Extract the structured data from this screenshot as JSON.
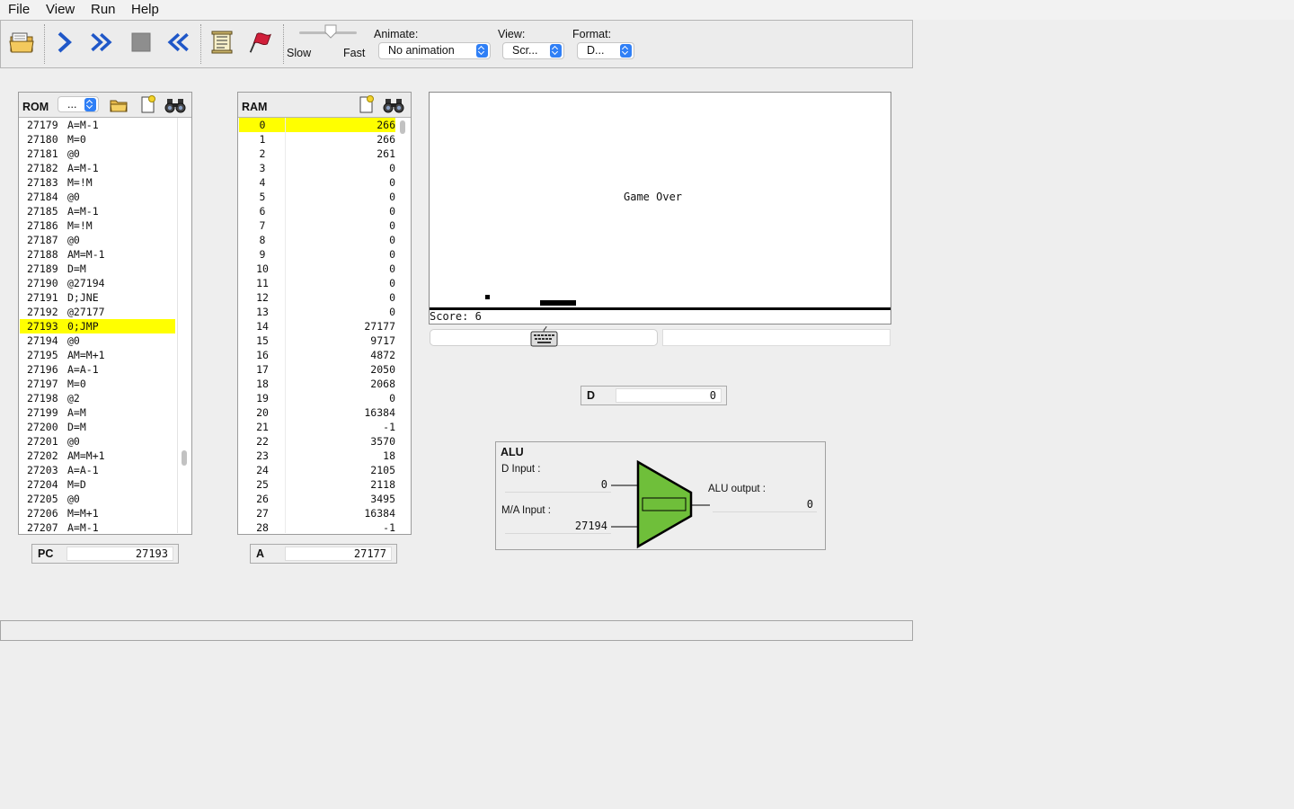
{
  "menu": [
    "File",
    "View",
    "Run",
    "Help"
  ],
  "toolbar": {
    "speed_slow": "Slow",
    "speed_fast": "Fast",
    "speed_level": 0.55,
    "animate_label": "Animate:",
    "animate_value": "No animation",
    "view_label": "View:",
    "view_value": "Scr...",
    "format_label": "Format:",
    "format_value": "D..."
  },
  "rom": {
    "title": "ROM",
    "combo_value": "...",
    "highlighted_index": 14,
    "rows": [
      {
        "addr": "27179",
        "inst": "A=M-1"
      },
      {
        "addr": "27180",
        "inst": "M=0"
      },
      {
        "addr": "27181",
        "inst": "@0"
      },
      {
        "addr": "27182",
        "inst": "A=M-1"
      },
      {
        "addr": "27183",
        "inst": "M=!M"
      },
      {
        "addr": "27184",
        "inst": "@0"
      },
      {
        "addr": "27185",
        "inst": "A=M-1"
      },
      {
        "addr": "27186",
        "inst": "M=!M"
      },
      {
        "addr": "27187",
        "inst": "@0"
      },
      {
        "addr": "27188",
        "inst": "AM=M-1"
      },
      {
        "addr": "27189",
        "inst": "D=M"
      },
      {
        "addr": "27190",
        "inst": "@27194"
      },
      {
        "addr": "27191",
        "inst": "D;JNE"
      },
      {
        "addr": "27192",
        "inst": "@27177"
      },
      {
        "addr": "27193",
        "inst": "0;JMP"
      },
      {
        "addr": "27194",
        "inst": "@0"
      },
      {
        "addr": "27195",
        "inst": "AM=M+1"
      },
      {
        "addr": "27196",
        "inst": "A=A-1"
      },
      {
        "addr": "27197",
        "inst": "M=0"
      },
      {
        "addr": "27198",
        "inst": "@2"
      },
      {
        "addr": "27199",
        "inst": "A=M"
      },
      {
        "addr": "27200",
        "inst": "D=M"
      },
      {
        "addr": "27201",
        "inst": "@0"
      },
      {
        "addr": "27202",
        "inst": "AM=M+1"
      },
      {
        "addr": "27203",
        "inst": "A=A-1"
      },
      {
        "addr": "27204",
        "inst": "M=D"
      },
      {
        "addr": "27205",
        "inst": "@0"
      },
      {
        "addr": "27206",
        "inst": "M=M+1"
      },
      {
        "addr": "27207",
        "inst": "A=M-1"
      }
    ]
  },
  "ram": {
    "title": "RAM",
    "highlighted_index": 0,
    "rows": [
      {
        "addr": "0",
        "val": "266"
      },
      {
        "addr": "1",
        "val": "266"
      },
      {
        "addr": "2",
        "val": "261"
      },
      {
        "addr": "3",
        "val": "0"
      },
      {
        "addr": "4",
        "val": "0"
      },
      {
        "addr": "5",
        "val": "0"
      },
      {
        "addr": "6",
        "val": "0"
      },
      {
        "addr": "7",
        "val": "0"
      },
      {
        "addr": "8",
        "val": "0"
      },
      {
        "addr": "9",
        "val": "0"
      },
      {
        "addr": "10",
        "val": "0"
      },
      {
        "addr": "11",
        "val": "0"
      },
      {
        "addr": "12",
        "val": "0"
      },
      {
        "addr": "13",
        "val": "0"
      },
      {
        "addr": "14",
        "val": "27177"
      },
      {
        "addr": "15",
        "val": "9717"
      },
      {
        "addr": "16",
        "val": "4872"
      },
      {
        "addr": "17",
        "val": "2050"
      },
      {
        "addr": "18",
        "val": "2068"
      },
      {
        "addr": "19",
        "val": "0"
      },
      {
        "addr": "20",
        "val": "16384"
      },
      {
        "addr": "21",
        "val": "-1"
      },
      {
        "addr": "22",
        "val": "3570"
      },
      {
        "addr": "23",
        "val": "18"
      },
      {
        "addr": "24",
        "val": "2105"
      },
      {
        "addr": "25",
        "val": "2118"
      },
      {
        "addr": "26",
        "val": "3495"
      },
      {
        "addr": "27",
        "val": "16384"
      },
      {
        "addr": "28",
        "val": "-1"
      }
    ]
  },
  "registers": {
    "pc_label": "PC",
    "pc_value": "27193",
    "a_label": "A",
    "a_value": "27177",
    "d_label": "D",
    "d_value": "0"
  },
  "screen": {
    "game_over": "Game Over",
    "score": "Score: 6"
  },
  "alu": {
    "title": "ALU",
    "d_input_label": "D Input :",
    "d_input_value": "0",
    "ma_input_label": "M/A Input :",
    "ma_input_value": "27194",
    "output_label": "ALU output :",
    "output_value": "0",
    "fill_color": "#6fbf3a"
  },
  "icons": {
    "load_program": "folder-open-icon",
    "single_step": "step-icon",
    "fast_forward": "fast-forward-icon",
    "stop": "stop-icon",
    "rewind": "rewind-icon",
    "script": "script-icon",
    "breakpoints": "breakpoint-flag-icon",
    "keyboard": "keyboard-icon"
  }
}
